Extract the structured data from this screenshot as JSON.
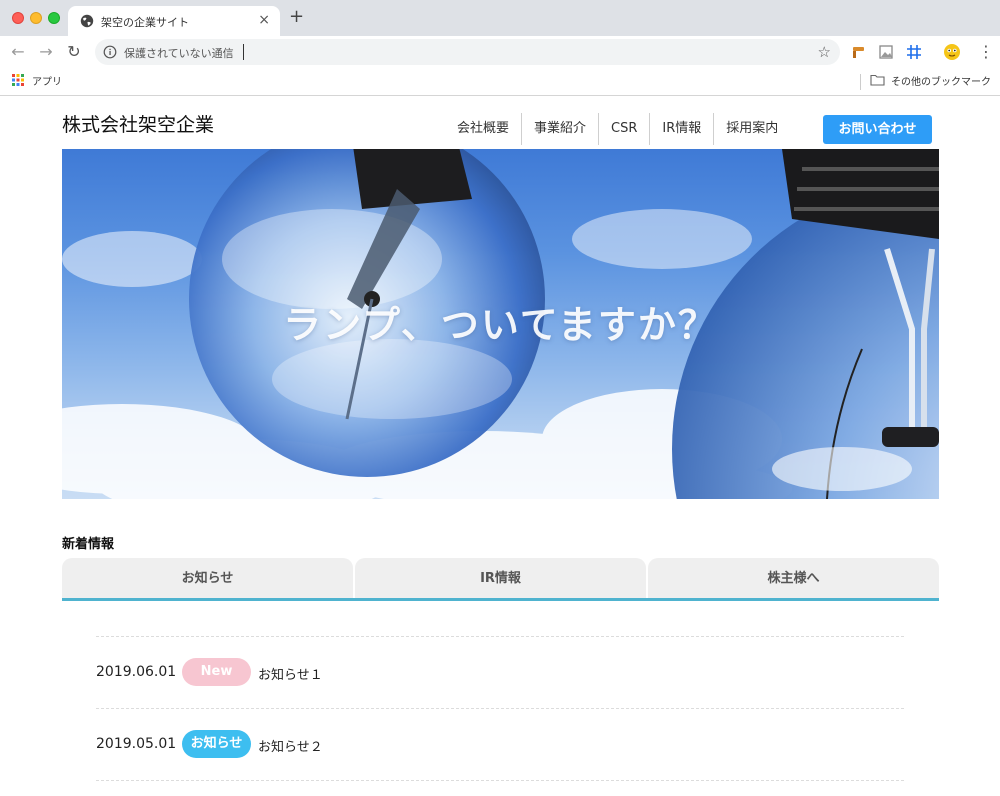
{
  "browser": {
    "tab_title": "架空の企業サイト",
    "tab_close": "×",
    "new_tab": "+",
    "back": "←",
    "forward": "→",
    "reload": "↻",
    "address_text": "保護されていない通信",
    "bookmark_star": "☆",
    "menu": "⋮",
    "apps_label": "アプリ",
    "other_bookmarks": "その他のブックマーク",
    "colors": {
      "tabstrip": "#dee1e6",
      "omnibox": "#f1f3f4"
    }
  },
  "site": {
    "logo": "株式会社架空企業",
    "nav": [
      {
        "label": "会社概要"
      },
      {
        "label": "事業紹介"
      },
      {
        "label": "CSR"
      },
      {
        "label": "IR情報"
      },
      {
        "label": "採用案内"
      }
    ],
    "contact_label": "お問い合わせ",
    "accent_color": "#2e9df7"
  },
  "hero": {
    "headline": "ランプ、ついてますか？"
  },
  "news": {
    "heading": "新着情報",
    "tabs": [
      {
        "label": "お知らせ"
      },
      {
        "label": "IR情報"
      },
      {
        "label": "株主様へ"
      }
    ],
    "tab_underline_color": "#4fb3cf",
    "items": [
      {
        "date": "2019.06.01",
        "badge": "New",
        "badge_color": "#f7c6d1",
        "title": "お知らせ１"
      },
      {
        "date": "2019.05.01",
        "badge": "お知らせ",
        "badge_color": "#3dbef0",
        "title": "お知らせ２"
      }
    ]
  }
}
